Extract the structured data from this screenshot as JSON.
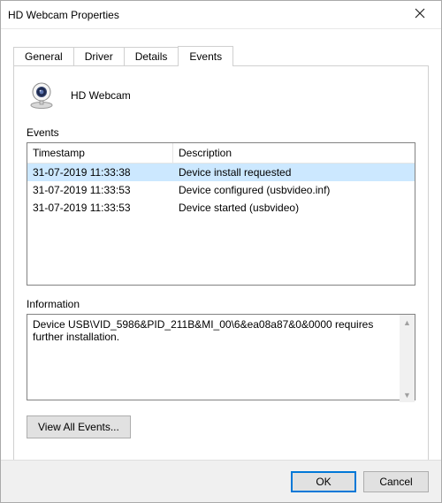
{
  "window": {
    "title": "HD Webcam Properties"
  },
  "tabs": {
    "general": "General",
    "driver": "Driver",
    "details": "Details",
    "events": "Events"
  },
  "device": {
    "name": "HD Webcam"
  },
  "events": {
    "sectionLabel": "Events",
    "cols": {
      "ts": "Timestamp",
      "desc": "Description"
    },
    "rows": [
      {
        "ts": "31-07-2019 11:33:38",
        "desc": "Device install requested"
      },
      {
        "ts": "31-07-2019 11:33:53",
        "desc": "Device configured (usbvideo.inf)"
      },
      {
        "ts": "31-07-2019 11:33:53",
        "desc": "Device started (usbvideo)"
      }
    ]
  },
  "info": {
    "label": "Information",
    "text": "Device USB\\VID_5986&PID_211B&MI_00\\6&ea08a87&0&0000 requires further installation."
  },
  "buttons": {
    "viewAll": "View All Events...",
    "ok": "OK",
    "cancel": "Cancel"
  }
}
